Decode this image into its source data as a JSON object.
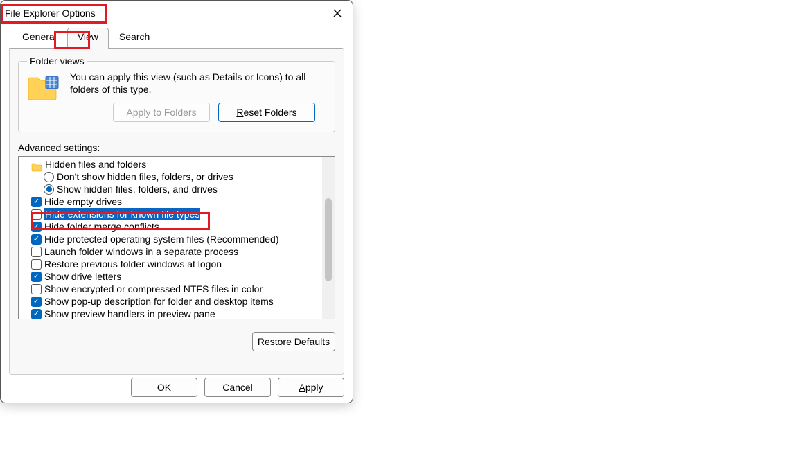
{
  "dialog": {
    "title": "File Explorer Options"
  },
  "tabs": {
    "general": "General",
    "view": "View",
    "search": "Search"
  },
  "folderViews": {
    "legend": "Folder views",
    "desc": "You can apply this view (such as Details or Icons) to all folders of this type.",
    "applyBtn": "Apply to Folders",
    "resetBtn_pre": "R",
    "resetBtn_rest": "eset Folders"
  },
  "advanced": {
    "label": "Advanced settings:",
    "hiddenHeader": "Hidden files and folders",
    "radDont": "Don't show hidden files, folders, or drives",
    "radShow": "Show hidden files, folders, and drives",
    "hideEmpty": "Hide empty drives",
    "hideExt": "Hide extensions for known file types",
    "hideMerge": "Hide folder merge conflicts",
    "hideProtected": "Hide protected operating system files (Recommended)",
    "launchSep": "Launch folder windows in a separate process",
    "restorePrev": "Restore previous folder windows at logon",
    "showDrive": "Show drive letters",
    "showEnc": "Show encrypted or compressed NTFS files in color",
    "showPopup": "Show pop-up description for folder and desktop items",
    "showPreview": "Show preview handlers in preview pane"
  },
  "restoreDefaults_pre": "Restore ",
  "restoreDefaults_u": "D",
  "restoreDefaults_rest": "efaults",
  "footer": {
    "ok": "OK",
    "cancel": "Cancel",
    "apply_u": "A",
    "apply_rest": "pply"
  }
}
